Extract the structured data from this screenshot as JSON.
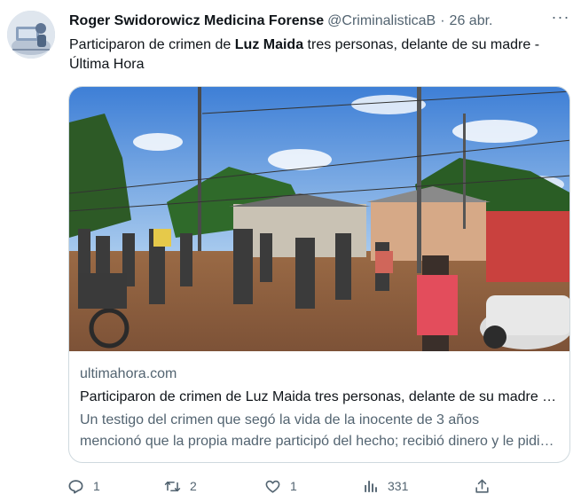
{
  "tweet": {
    "author_name": "Roger Swidorowicz Medicina Forense",
    "author_handle": "@CriminalisticaB",
    "separator": "·",
    "date": "26 abr.",
    "more_label": "···",
    "text_before": "Participaron de crimen de ",
    "text_bold": "Luz Maida",
    "text_after": " tres personas, delante de su madre - Última Hora"
  },
  "card": {
    "domain": "ultimahora.com",
    "title": "Participaron de crimen de Luz Maida tres personas, delante de su madre - Última Hora",
    "description_line1": "Un testigo del crimen que segó la vida de la inocente de 3 años",
    "description_line2": "mencionó que la propia madre participó del hecho; recibió dinero y le pidió a los autores que no la dejen sufrir"
  },
  "actions": {
    "reply_count": "1",
    "retweet_count": "2",
    "like_count": "1",
    "views_count": "331"
  },
  "icons": {
    "reply": "reply-icon",
    "retweet": "retweet-icon",
    "like": "heart-icon",
    "views": "views-icon",
    "share": "share-icon"
  },
  "colors": {
    "text_primary": "#0f1419",
    "text_secondary": "#536471",
    "border": "#cfd9de"
  }
}
